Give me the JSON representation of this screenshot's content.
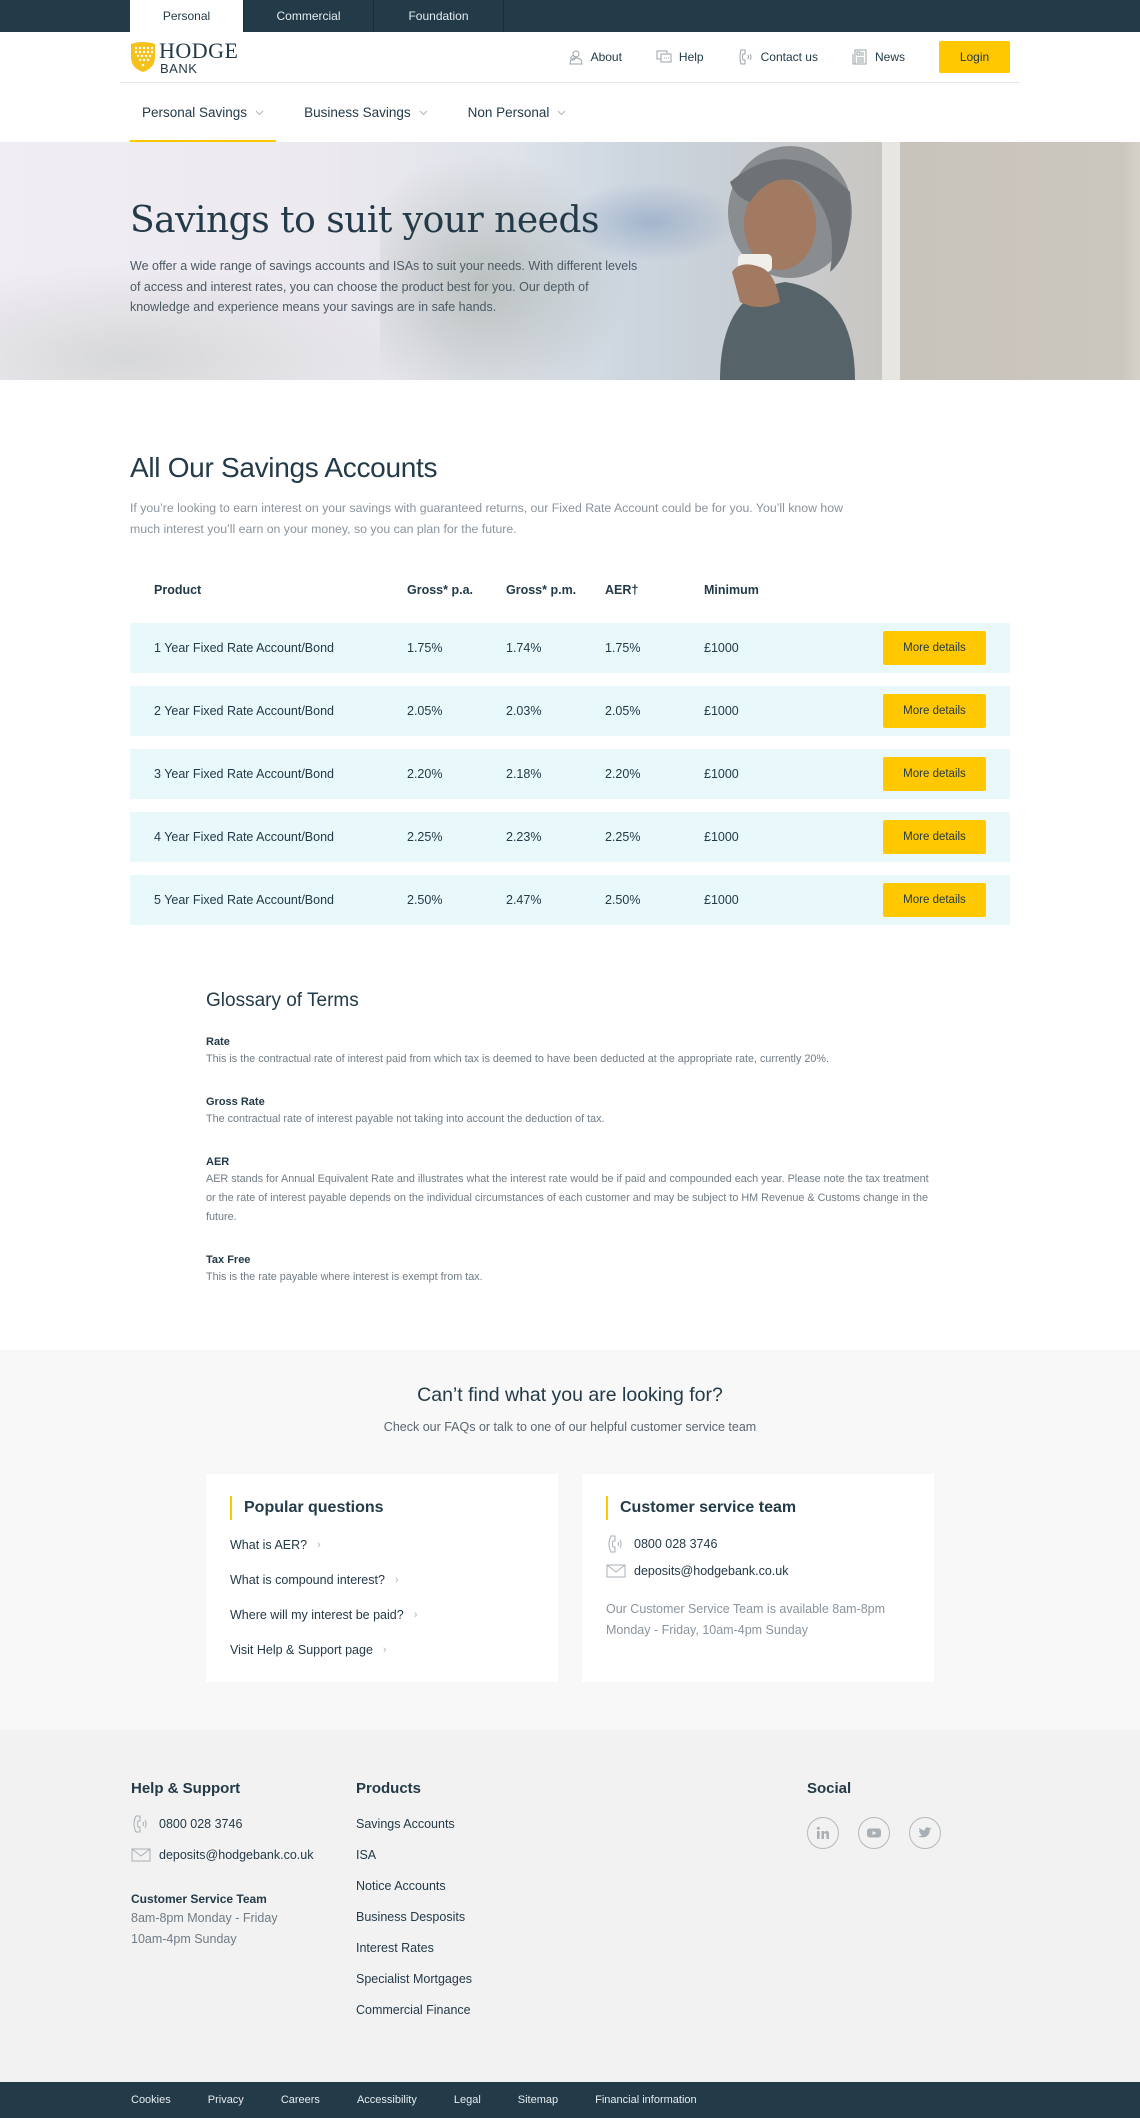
{
  "topbar": {
    "tabs": [
      {
        "label": "Personal",
        "active": true
      },
      {
        "label": "Commercial",
        "active": false
      },
      {
        "label": "Foundation",
        "active": false
      }
    ]
  },
  "header": {
    "logo": {
      "name": "HODGE",
      "sub": "BANK"
    },
    "utility": [
      {
        "label": "About",
        "icon": "people-icon"
      },
      {
        "label": "Help",
        "icon": "chat-icon"
      },
      {
        "label": "Contact us",
        "icon": "phone-icon"
      },
      {
        "label": "News",
        "icon": "newspaper-icon"
      }
    ],
    "login_label": "Login"
  },
  "nav": {
    "items": [
      {
        "label": "Personal Savings",
        "active": true
      },
      {
        "label": "Business Savings",
        "active": false
      },
      {
        "label": "Non Personal",
        "active": false
      }
    ]
  },
  "hero": {
    "title": "Savings to suit your needs",
    "text": "We offer a wide range of savings accounts and ISAs to suit your needs. With different levels of access and interest rates, you can choose the product best for you. Our depth of knowledge and experience means your savings are in safe hands."
  },
  "savings": {
    "title": "All Our Savings Accounts",
    "intro": "If you’re looking to earn interest on your savings with guaranteed returns, our Fixed Rate Account could be for you. You’ll know how much interest you’ll earn on your money, so you can plan for the future.",
    "columns": [
      "Product",
      "Gross* p.a.",
      "Gross* p.m.",
      "AER†",
      "Minimum"
    ],
    "rows": [
      {
        "product": "1 Year Fixed Rate Account/Bond",
        "gross_pa": "1.75%",
        "gross_pm": "1.74%",
        "aer": "1.75%",
        "minimum": "£1000",
        "button": "More details"
      },
      {
        "product": "2 Year Fixed Rate Account/Bond",
        "gross_pa": "2.05%",
        "gross_pm": "2.03%",
        "aer": "2.05%",
        "minimum": "£1000",
        "button": "More details"
      },
      {
        "product": "3 Year Fixed Rate Account/Bond",
        "gross_pa": "2.20%",
        "gross_pm": "2.18%",
        "aer": "2.20%",
        "minimum": "£1000",
        "button": "More details"
      },
      {
        "product": "4 Year Fixed Rate Account/Bond",
        "gross_pa": "2.25%",
        "gross_pm": "2.23%",
        "aer": "2.25%",
        "minimum": "£1000",
        "button": "More details"
      },
      {
        "product": "5 Year Fixed Rate Account/Bond",
        "gross_pa": "2.50%",
        "gross_pm": "2.47%",
        "aer": "2.50%",
        "minimum": "£1000",
        "button": "More details"
      }
    ]
  },
  "glossary": {
    "title": "Glossary of Terms",
    "terms": [
      {
        "term": "Rate",
        "definition": "This is the contractual rate of interest paid from which tax is deemed to have been deducted at the appropriate rate, currently 20%."
      },
      {
        "term": "Gross Rate",
        "definition": "The contractual rate of interest payable not taking into account the deduction of tax."
      },
      {
        "term": "AER",
        "definition": "AER stands for Annual Equivalent Rate and illustrates what the interest rate would be if paid and compounded each year. Please note the tax treatment or the rate of interest payable depends on the individual circumstances of each customer and may be subject to HM Revenue & Customs change in the future."
      },
      {
        "term": "Tax Free",
        "definition": "This is the rate payable where interest is exempt from tax."
      }
    ]
  },
  "help": {
    "title": "Can’t find what you are looking for?",
    "subtitle": "Check our FAQs or talk to one of our helpful customer service team",
    "popular": {
      "title": "Popular questions",
      "links": [
        "What is AER?",
        "What is compound interest?",
        "Where will my interest be paid?",
        "Visit Help & Support page"
      ]
    },
    "service": {
      "title": "Customer service team",
      "phone": "0800 028 3746",
      "email": "deposits@hodgebank.co.uk",
      "availability": "Our Customer Service Team is available 8am-8pm Monday - Friday, 10am-4pm Sunday"
    }
  },
  "footer": {
    "support": {
      "title": "Help & Support",
      "phone": "0800 028 3746",
      "email": "deposits@hodgebank.co.uk",
      "team_title": "Customer Service Team",
      "hours": [
        "8am-8pm Monday - Friday",
        "10am-4pm Sunday"
      ]
    },
    "products": {
      "title": "Products",
      "links": [
        "Savings Accounts",
        "ISA",
        "Notice Accounts",
        "Business Desposits",
        "Interest Rates",
        "Specialist Mortgages",
        "Commercial Finance"
      ]
    },
    "social": {
      "title": "Social",
      "icons": [
        "linkedin-icon",
        "youtube-icon",
        "twitter-icon"
      ]
    },
    "bottom_links": [
      "Cookies",
      "Privacy",
      "Careers",
      "Accessibility",
      "Legal",
      "Sitemap",
      "Financial information"
    ]
  },
  "colors": {
    "navy": "#233a48",
    "accent_yellow": "#ffc800",
    "row_bg": "#e8f8fb",
    "muted_text": "#8a949c"
  }
}
